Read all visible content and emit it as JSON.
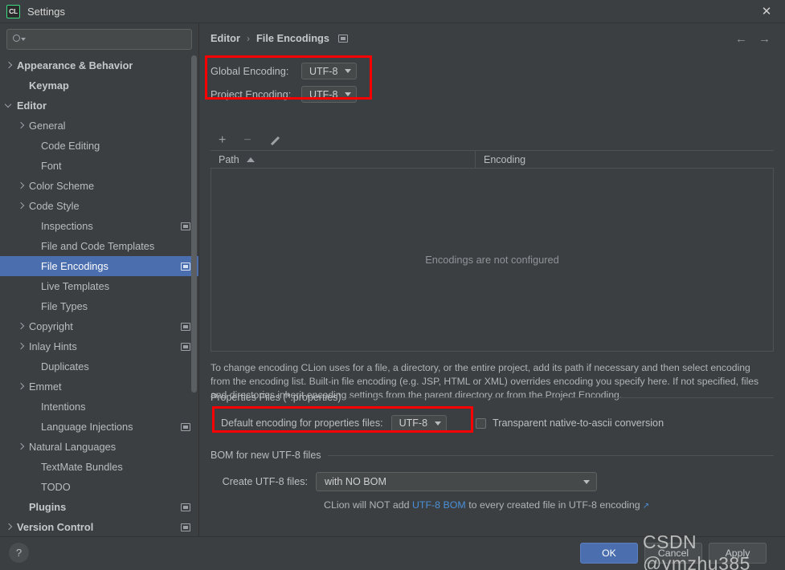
{
  "window": {
    "logo_text": "CL",
    "title": "Settings",
    "close_label": "✕"
  },
  "sidebar": {
    "search": {
      "value": "",
      "placeholder": ""
    },
    "items": [
      {
        "label": "Appearance & Behavior",
        "chevron": "right",
        "bold": true,
        "indent": 6,
        "badge": false,
        "selected": false
      },
      {
        "label": "Keymap",
        "chevron": "none",
        "bold": true,
        "indent": 21,
        "badge": false,
        "selected": false
      },
      {
        "label": "Editor",
        "chevron": "down",
        "bold": true,
        "indent": 6,
        "badge": false,
        "selected": false
      },
      {
        "label": "General",
        "chevron": "right",
        "bold": false,
        "indent": 21,
        "badge": false,
        "selected": false
      },
      {
        "label": "Code Editing",
        "chevron": "none",
        "bold": false,
        "indent": 36,
        "badge": false,
        "selected": false
      },
      {
        "label": "Font",
        "chevron": "none",
        "bold": false,
        "indent": 36,
        "badge": false,
        "selected": false
      },
      {
        "label": "Color Scheme",
        "chevron": "right",
        "bold": false,
        "indent": 21,
        "badge": false,
        "selected": false
      },
      {
        "label": "Code Style",
        "chevron": "right",
        "bold": false,
        "indent": 21,
        "badge": false,
        "selected": false
      },
      {
        "label": "Inspections",
        "chevron": "none",
        "bold": false,
        "indent": 36,
        "badge": true,
        "selected": false
      },
      {
        "label": "File and Code Templates",
        "chevron": "none",
        "bold": false,
        "indent": 36,
        "badge": false,
        "selected": false
      },
      {
        "label": "File Encodings",
        "chevron": "none",
        "bold": false,
        "indent": 36,
        "badge": true,
        "selected": true
      },
      {
        "label": "Live Templates",
        "chevron": "none",
        "bold": false,
        "indent": 36,
        "badge": false,
        "selected": false
      },
      {
        "label": "File Types",
        "chevron": "none",
        "bold": false,
        "indent": 36,
        "badge": false,
        "selected": false
      },
      {
        "label": "Copyright",
        "chevron": "right",
        "bold": false,
        "indent": 21,
        "badge": true,
        "selected": false
      },
      {
        "label": "Inlay Hints",
        "chevron": "right",
        "bold": false,
        "indent": 21,
        "badge": true,
        "selected": false
      },
      {
        "label": "Duplicates",
        "chevron": "none",
        "bold": false,
        "indent": 36,
        "badge": false,
        "selected": false
      },
      {
        "label": "Emmet",
        "chevron": "right",
        "bold": false,
        "indent": 21,
        "badge": false,
        "selected": false
      },
      {
        "label": "Intentions",
        "chevron": "none",
        "bold": false,
        "indent": 36,
        "badge": false,
        "selected": false
      },
      {
        "label": "Language Injections",
        "chevron": "none",
        "bold": false,
        "indent": 36,
        "badge": true,
        "selected": false
      },
      {
        "label": "Natural Languages",
        "chevron": "right",
        "bold": false,
        "indent": 21,
        "badge": false,
        "selected": false
      },
      {
        "label": "TextMate Bundles",
        "chevron": "none",
        "bold": false,
        "indent": 36,
        "badge": false,
        "selected": false
      },
      {
        "label": "TODO",
        "chevron": "none",
        "bold": false,
        "indent": 36,
        "badge": false,
        "selected": false
      },
      {
        "label": "Plugins",
        "chevron": "none",
        "bold": true,
        "indent": 21,
        "badge": true,
        "selected": false
      },
      {
        "label": "Version Control",
        "chevron": "right",
        "bold": true,
        "indent": 6,
        "badge": true,
        "selected": false
      }
    ]
  },
  "main": {
    "breadcrumb": {
      "root": "Editor",
      "separator": "›",
      "leaf": "File Encodings"
    },
    "nav": {
      "back": "←",
      "forward": "→"
    },
    "encodings": {
      "global_label": "Global Encoding:",
      "global_value": "UTF-8",
      "project_label": "Project Encoding:",
      "project_value": "UTF-8"
    },
    "table": {
      "toolbar": {
        "add": "+",
        "remove": "−",
        "edit": "edit-pencil"
      },
      "columns": [
        "Path",
        "Encoding"
      ],
      "rows": [],
      "empty_message": "Encodings are not configured"
    },
    "note": "To change encoding CLion uses for a file, a directory, or the entire project, add its path if necessary and then select encoding from the encoding list. Built-in file encoding (e.g. JSP, HTML or XML) overrides encoding you specify here. If not specified, files and directories inherit encoding settings from the parent directory or from the Project Encoding.",
    "properties_section": {
      "title": "Properties Files (*.properties)",
      "default_encoding_label": "Default encoding for properties files:",
      "default_encoding_value": "UTF-8",
      "transparent_label": "Transparent native-to-ascii conversion",
      "transparent_checked": false
    },
    "bom_section": {
      "title": "BOM for new UTF-8 files",
      "create_label": "Create UTF-8 files:",
      "create_value": "with NO BOM",
      "hint_prefix": "CLion will NOT add ",
      "hint_link": "UTF-8 BOM",
      "hint_suffix": " to every created file in UTF-8 encoding",
      "external_link_glyph": "↗"
    }
  },
  "footer": {
    "help": "?",
    "ok": "OK",
    "cancel": "Cancel",
    "apply": "Apply"
  },
  "watermark": {
    "text": "CSDN @ymzhu385"
  },
  "colors": {
    "background": "#3c3f41",
    "selection": "#4b6eaf",
    "highlight_box": "#fb0000",
    "link": "#4a90d9",
    "text": "#bbbbbb"
  }
}
